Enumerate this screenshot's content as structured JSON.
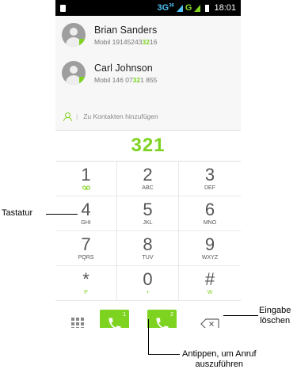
{
  "status_bar": {
    "network": "3G",
    "network_sup": "36",
    "g_label": "G",
    "time": "18:01"
  },
  "contacts": [
    {
      "name": "Brian Sanders",
      "number_prefix": "Mobil 19145243",
      "number_match": "32",
      "number_suffix": "16"
    },
    {
      "name": "Carl Johnson",
      "number_prefix": "Mobil 146 07",
      "number_match": "32",
      "number_suffix": "1 855"
    }
  ],
  "add_contact": {
    "separator": "|",
    "label": "Zu Kontakten hinzufügen"
  },
  "dial_display": "321",
  "keys": [
    {
      "digit": "1",
      "letters": ""
    },
    {
      "digit": "2",
      "letters": "ABC"
    },
    {
      "digit": "3",
      "letters": "DEF"
    },
    {
      "digit": "4",
      "letters": "GHI"
    },
    {
      "digit": "5",
      "letters": "JKL"
    },
    {
      "digit": "6",
      "letters": "MNO"
    },
    {
      "digit": "7",
      "letters": "PQRS"
    },
    {
      "digit": "8",
      "letters": "TUV"
    },
    {
      "digit": "9",
      "letters": "WXYZ"
    },
    {
      "digit": "*",
      "letters": "P"
    },
    {
      "digit": "0",
      "letters": "+"
    },
    {
      "digit": "#",
      "letters": "W"
    }
  ],
  "call_buttons": {
    "sim1": "1",
    "sim2": "2"
  },
  "icons": {
    "voicemail": "voicemail-icon",
    "dialpad": "dialpad-icon",
    "phone": "phone-icon",
    "backspace": "backspace-icon",
    "person_add": "person-add-icon"
  },
  "accent_color": "#7ed321",
  "annotations": {
    "tastatur": "Tastatur",
    "eingabe_line1": "Eingabe",
    "eingabe_line2": "löschen",
    "antippen_line1": "Antippen, um Anruf",
    "antippen_line2": "auszuführen"
  }
}
